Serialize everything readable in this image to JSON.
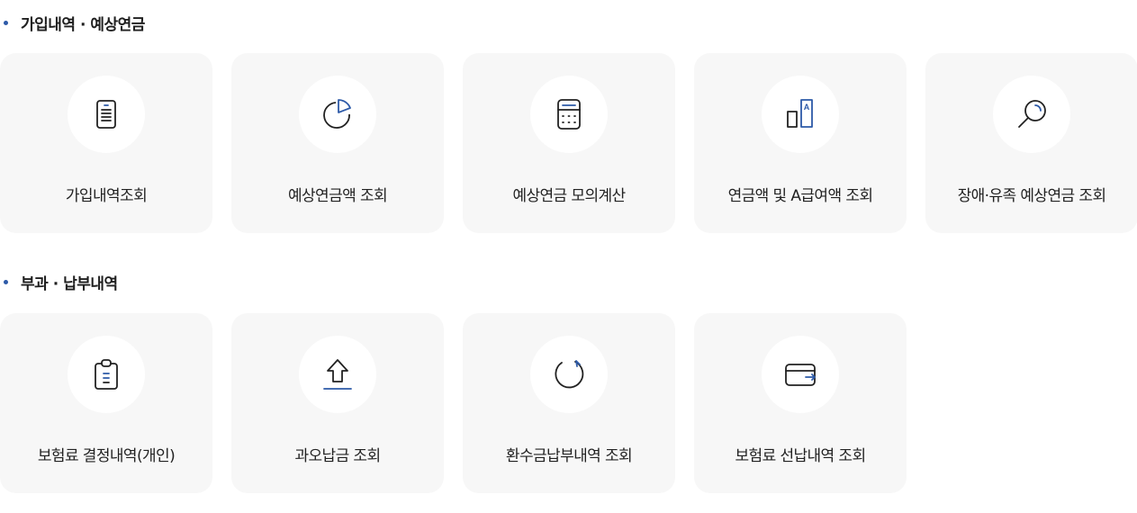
{
  "colors": {
    "accent": "#2d5aa8",
    "icon_stroke": "#222222",
    "card_bg": "#f7f7f7",
    "circle_bg": "#ffffff"
  },
  "sections": [
    {
      "title": "가입내역 · 예상연금",
      "items": [
        {
          "label": "가입내역조회",
          "icon": "document-list-icon"
        },
        {
          "label": "예상연금액 조회",
          "icon": "pie-chart-icon"
        },
        {
          "label": "예상연금 모의계산",
          "icon": "calculator-icon"
        },
        {
          "label": "연금액 및 A급여액 조회",
          "icon": "bar-chart-a-icon"
        },
        {
          "label": "장애·유족 예상연금 조회",
          "icon": "magnifier-icon"
        }
      ]
    },
    {
      "title": "부과 · 납부내역",
      "items": [
        {
          "label": "보험료 결정내역(개인)",
          "icon": "clipboard-icon"
        },
        {
          "label": "과오납금 조회",
          "icon": "upload-arrow-icon"
        },
        {
          "label": "환수금납부내역 조회",
          "icon": "refresh-icon"
        },
        {
          "label": "보험료 선납내역 조회",
          "icon": "wallet-icon"
        }
      ]
    }
  ]
}
